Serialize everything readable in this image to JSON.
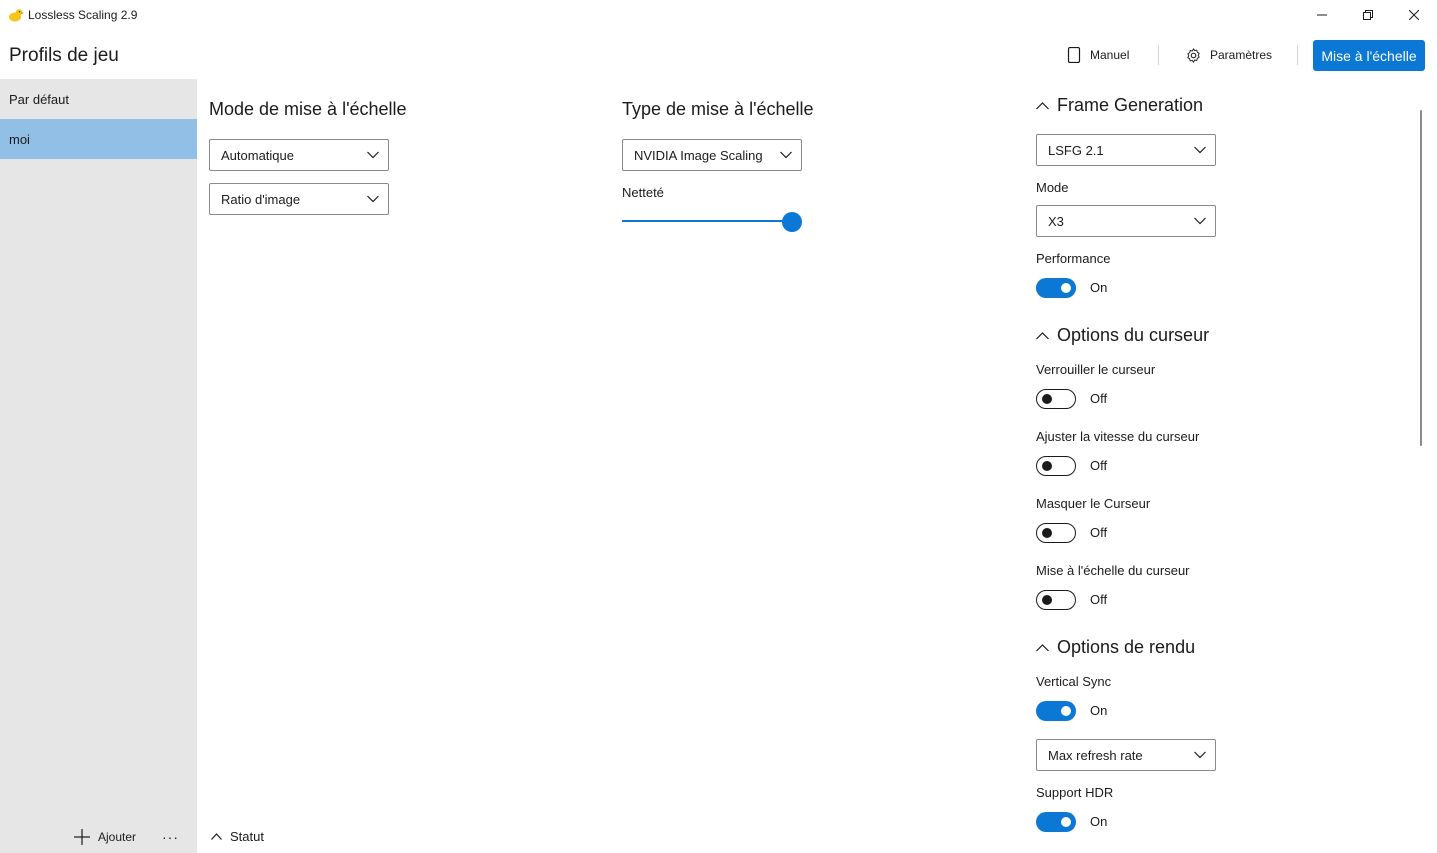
{
  "window": {
    "title": "Lossless Scaling 2.9",
    "controls": [
      "minimize",
      "restore",
      "close"
    ]
  },
  "header": {
    "profiles_title": "Profils de jeu",
    "manual_label": "Manuel",
    "settings_label": "Paramètres",
    "scale_button_label": "Mise à l'échelle"
  },
  "sidebar": {
    "items": [
      {
        "label": "Par défaut",
        "selected": false
      },
      {
        "label": "moi",
        "selected": true
      }
    ],
    "add_label": "Ajouter",
    "more_label": "···"
  },
  "scaling_mode": {
    "title": "Mode de mise à l'échelle",
    "mode_value": "Automatique",
    "ratio_value": "Ratio d'image"
  },
  "scaling_type": {
    "title": "Type de mise à l'échelle",
    "type_value": "NVIDIA Image Scaling",
    "sharpness_label": "Netteté",
    "sharpness_level": 1.0
  },
  "frame_generation": {
    "title": "Frame Generation",
    "version_value": "LSFG 2.1",
    "mode_label": "Mode",
    "mode_value": "X3",
    "performance_label": "Performance",
    "performance_state": "On"
  },
  "cursor_options": {
    "title": "Options du curseur",
    "lock_label": "Verrouiller le curseur",
    "lock_state": "Off",
    "speed_label": "Ajuster la vitesse du curseur",
    "speed_state": "Off",
    "hide_label": "Masquer le Curseur",
    "hide_state": "Off",
    "scale_label": "Mise à l'échelle du curseur",
    "scale_state": "Off"
  },
  "render_options": {
    "title": "Options de rendu",
    "vsync_label": "Vertical Sync",
    "vsync_state": "On",
    "refresh_value": "Max refresh rate",
    "hdr_label": "Support HDR",
    "hdr_state": "On"
  },
  "status": {
    "label": "Statut"
  },
  "colors": {
    "accent": "#0a78d4",
    "selected_item": "#92bfe6",
    "sidebar_bg": "#e6e6e6"
  }
}
